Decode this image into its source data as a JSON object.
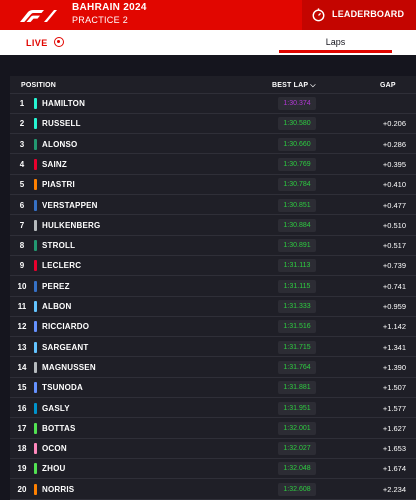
{
  "header": {
    "event_title": "BAHRAIN 2024",
    "session": "PRACTICE 2",
    "leaderboard_label": "LEADERBOARD",
    "brand_color": "#e10600"
  },
  "tabs": {
    "live_label": "LIVE",
    "laps_label": "Laps"
  },
  "table": {
    "col_position": "POSITION",
    "col_best_lap": "BEST LAP",
    "col_gap": "GAP",
    "rows": [
      {
        "pos": "1",
        "driver": "HAMILTON",
        "time": "1:30.374",
        "gap": "",
        "team_color": "#27f4d2",
        "fastest": true
      },
      {
        "pos": "2",
        "driver": "RUSSELL",
        "time": "1:30.580",
        "gap": "+0.206",
        "team_color": "#27f4d2",
        "fastest": false
      },
      {
        "pos": "3",
        "driver": "ALONSO",
        "time": "1:30.660",
        "gap": "+0.286",
        "team_color": "#229971",
        "fastest": false
      },
      {
        "pos": "4",
        "driver": "SAINZ",
        "time": "1:30.769",
        "gap": "+0.395",
        "team_color": "#e8002d",
        "fastest": false
      },
      {
        "pos": "5",
        "driver": "PIASTRI",
        "time": "1:30.784",
        "gap": "+0.410",
        "team_color": "#ff8000",
        "fastest": false
      },
      {
        "pos": "6",
        "driver": "VERSTAPPEN",
        "time": "1:30.851",
        "gap": "+0.477",
        "team_color": "#3671c6",
        "fastest": false
      },
      {
        "pos": "7",
        "driver": "HULKENBERG",
        "time": "1:30.884",
        "gap": "+0.510",
        "team_color": "#b6babd",
        "fastest": false
      },
      {
        "pos": "8",
        "driver": "STROLL",
        "time": "1:30.891",
        "gap": "+0.517",
        "team_color": "#229971",
        "fastest": false
      },
      {
        "pos": "9",
        "driver": "LECLERC",
        "time": "1:31.113",
        "gap": "+0.739",
        "team_color": "#e8002d",
        "fastest": false
      },
      {
        "pos": "10",
        "driver": "PEREZ",
        "time": "1:31.115",
        "gap": "+0.741",
        "team_color": "#3671c6",
        "fastest": false
      },
      {
        "pos": "11",
        "driver": "ALBON",
        "time": "1:31.333",
        "gap": "+0.959",
        "team_color": "#64c4ff",
        "fastest": false
      },
      {
        "pos": "12",
        "driver": "RICCIARDO",
        "time": "1:31.516",
        "gap": "+1.142",
        "team_color": "#6692ff",
        "fastest": false
      },
      {
        "pos": "13",
        "driver": "SARGEANT",
        "time": "1:31.715",
        "gap": "+1.341",
        "team_color": "#64c4ff",
        "fastest": false
      },
      {
        "pos": "14",
        "driver": "MAGNUSSEN",
        "time": "1:31.764",
        "gap": "+1.390",
        "team_color": "#b6babd",
        "fastest": false
      },
      {
        "pos": "15",
        "driver": "TSUNODA",
        "time": "1:31.881",
        "gap": "+1.507",
        "team_color": "#6692ff",
        "fastest": false
      },
      {
        "pos": "16",
        "driver": "GASLY",
        "time": "1:31.951",
        "gap": "+1.577",
        "team_color": "#0093cc",
        "fastest": false
      },
      {
        "pos": "17",
        "driver": "BOTTAS",
        "time": "1:32.001",
        "gap": "+1.627",
        "team_color": "#52e252",
        "fastest": false
      },
      {
        "pos": "18",
        "driver": "OCON",
        "time": "1:32.027",
        "gap": "+1.653",
        "team_color": "#ff87bc",
        "fastest": false
      },
      {
        "pos": "19",
        "driver": "ZHOU",
        "time": "1:32.048",
        "gap": "+1.674",
        "team_color": "#52e252",
        "fastest": false
      },
      {
        "pos": "20",
        "driver": "NORRIS",
        "time": "1:32.608",
        "gap": "+2.234",
        "team_color": "#ff8000",
        "fastest": false
      }
    ]
  }
}
